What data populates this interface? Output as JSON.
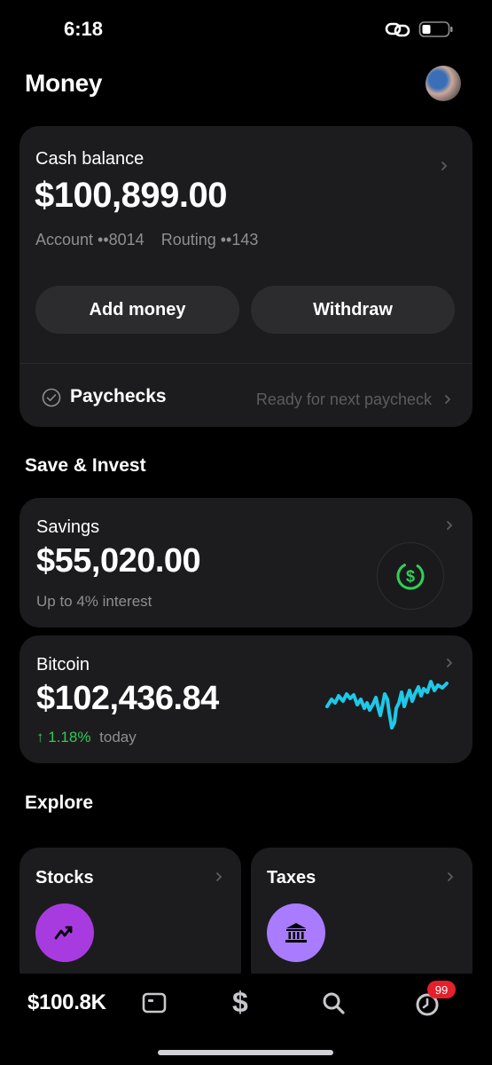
{
  "status_bar": {
    "time": "6:18"
  },
  "header": {
    "title": "Money"
  },
  "cash": {
    "label": "Cash balance",
    "amount": "$100,899.00",
    "account": "Account ••8014",
    "routing": "Routing ••143",
    "add_money": "Add money",
    "withdraw": "Withdraw",
    "paychecks_label": "Paychecks",
    "paychecks_status": "Ready for next paycheck"
  },
  "save_invest": {
    "title": "Save & Invest"
  },
  "savings": {
    "label": "Savings",
    "amount": "$55,020.00",
    "subtitle": "Up to 4% interest",
    "icon": "dollar-circle-icon",
    "accent": "#2fd158"
  },
  "bitcoin": {
    "label": "Bitcoin",
    "amount": "$102,436.84",
    "change": "1.18%",
    "change_suffix": "today",
    "change_color": "#34c759",
    "sparkline_color": "#1ec8e8"
  },
  "explore": {
    "title": "Explore",
    "cards": [
      {
        "label": "Stocks",
        "icon": "trend-icon",
        "color": "#a83be0"
      },
      {
        "label": "Taxes",
        "icon": "bank-icon",
        "color": "#a97bff"
      }
    ]
  },
  "tab_bar": {
    "balance": "$100.8K",
    "notifications_badge": "99"
  }
}
